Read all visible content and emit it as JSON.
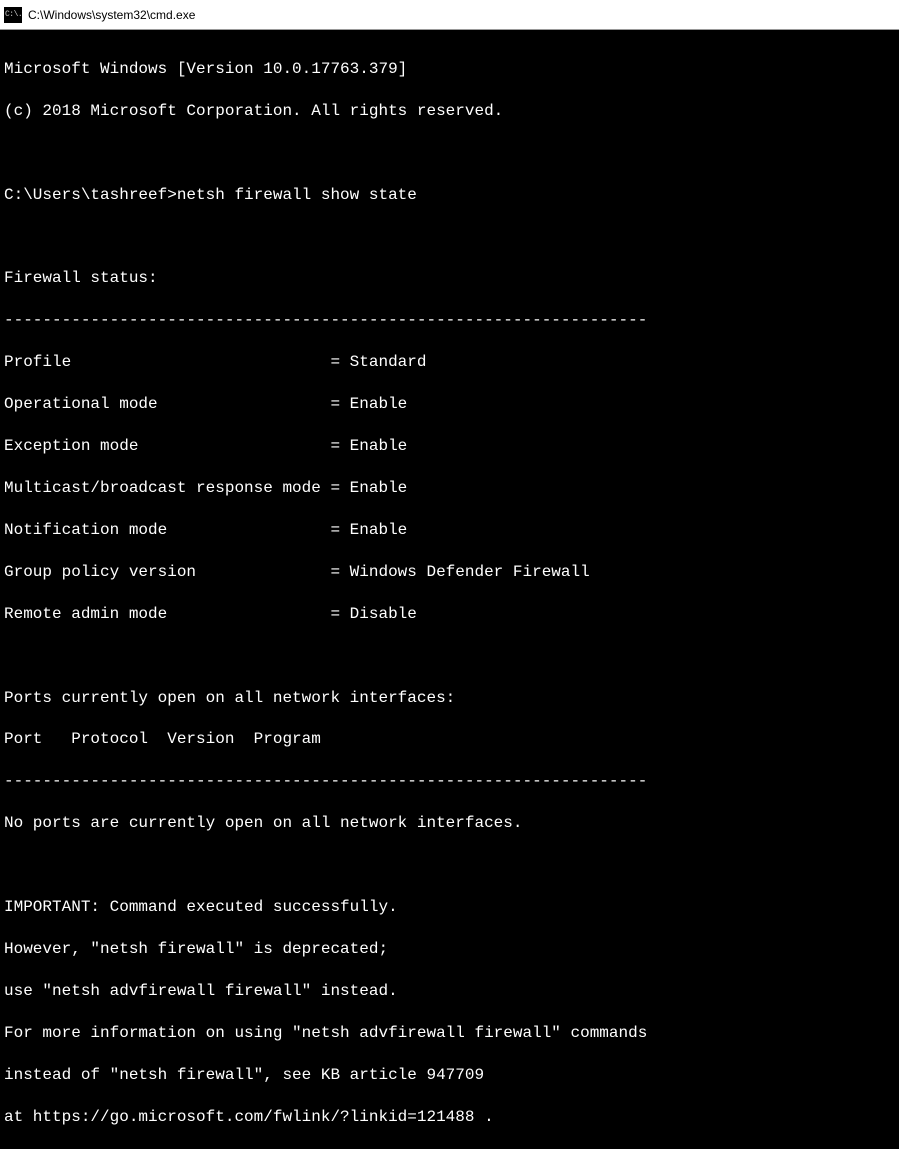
{
  "titlebar": {
    "icon_text": "C:\\.",
    "title": "C:\\Windows\\system32\\cmd.exe"
  },
  "header": {
    "line1": "Microsoft Windows [Version 10.0.17763.379]",
    "line2": "(c) 2018 Microsoft Corporation. All rights reserved."
  },
  "prompt": {
    "path": "C:\\Users\\tashreef>",
    "command": "netsh firewall show state"
  },
  "output": {
    "status_header": "Firewall status:",
    "separator": "-------------------------------------------------------------------",
    "rows": [
      {
        "label": "Profile                           ",
        "value": "Standard"
      },
      {
        "label": "Operational mode                  ",
        "value": "Enable"
      },
      {
        "label": "Exception mode                    ",
        "value": "Enable"
      },
      {
        "label": "Multicast/broadcast response mode ",
        "value": "Enable"
      },
      {
        "label": "Notification mode                 ",
        "value": "Enable"
      },
      {
        "label": "Group policy version              ",
        "value": "Windows Defender Firewall"
      },
      {
        "label": "Remote admin mode                 ",
        "value": "Disable"
      }
    ],
    "ports_header": "Ports currently open on all network interfaces:",
    "ports_columns": "Port   Protocol  Version  Program",
    "no_ports": "No ports are currently open on all network interfaces.",
    "notice": {
      "line1": "IMPORTANT: Command executed successfully.",
      "line2": "However, \"netsh firewall\" is deprecated;",
      "line3": "use \"netsh advfirewall firewall\" instead.",
      "line4": "For more information on using \"netsh advfirewall firewall\" commands",
      "line5": "instead of \"netsh firewall\", see KB article 947709",
      "line6": "at https://go.microsoft.com/fwlink/?linkid=121488 ."
    }
  }
}
